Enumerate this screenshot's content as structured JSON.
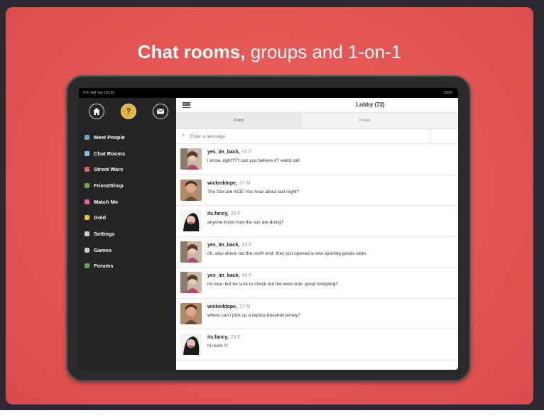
{
  "headline": {
    "bold": "Chat rooms,",
    "rest": "groups and 1-on-1"
  },
  "status": {
    "time": "9:41 AM  Tue Oct 30",
    "battery": "100%"
  },
  "sidebar": {
    "top_icons": [
      "home-icon",
      "help-icon",
      "mail-icon"
    ],
    "items": [
      {
        "label": "Meet People",
        "icon": "search-icon",
        "color": "#6fa8dc"
      },
      {
        "label": "Chat Rooms",
        "icon": "chat-icon",
        "color": "#7ec8d8"
      },
      {
        "label": "Street Wars",
        "icon": "fist-icon",
        "color": "#e06666"
      },
      {
        "label": "FriendShop",
        "icon": "tag-icon",
        "color": "#6aa84f"
      },
      {
        "label": "Match Me",
        "icon": "heart-icon",
        "color": "#e06699"
      },
      {
        "label": "Gold",
        "icon": "coin-icon",
        "color": "#f1c232"
      },
      {
        "label": "Settings",
        "icon": "gear-icon",
        "color": "#cccccc"
      },
      {
        "label": "Games",
        "icon": "gamepad-icon",
        "color": "#cccccc"
      },
      {
        "label": "Forums",
        "icon": "forum-icon",
        "color": "#6aa84f"
      }
    ]
  },
  "chat": {
    "title": "Lobby (72)",
    "tabs": [
      "Public",
      "Private"
    ],
    "placeholder": "Enter a message",
    "messages": [
      {
        "user": "yes_im_back,",
        "meta": "45 F",
        "text": "i know, right??? can you believe it? weird call",
        "avatar": "a"
      },
      {
        "user": "wickeddope,",
        "meta": "27 M",
        "text": "The Sox are ACE! You hear about last night?",
        "avatar": "b"
      },
      {
        "user": "its.fancy,",
        "meta": "29 F",
        "text": "anyone know how the sox are doing?",
        "avatar": "c"
      },
      {
        "user": "yes_im_back,",
        "meta": "45 F",
        "text": "oh, also check out the north end. they just opened a new sporting goods store",
        "avatar": "a"
      },
      {
        "user": "yes_im_back,",
        "meta": "45 F",
        "text": "no clue, but be sure to check out the west side. great shopping!!",
        "avatar": "a"
      },
      {
        "user": "wickeddope,",
        "meta": "27 M",
        "text": "where can i pick up a replica baseball jersey?",
        "avatar": "b"
      },
      {
        "user": "its.fancy,",
        "meta": "29 F",
        "text": "hi room !!!",
        "avatar": "c"
      }
    ]
  }
}
